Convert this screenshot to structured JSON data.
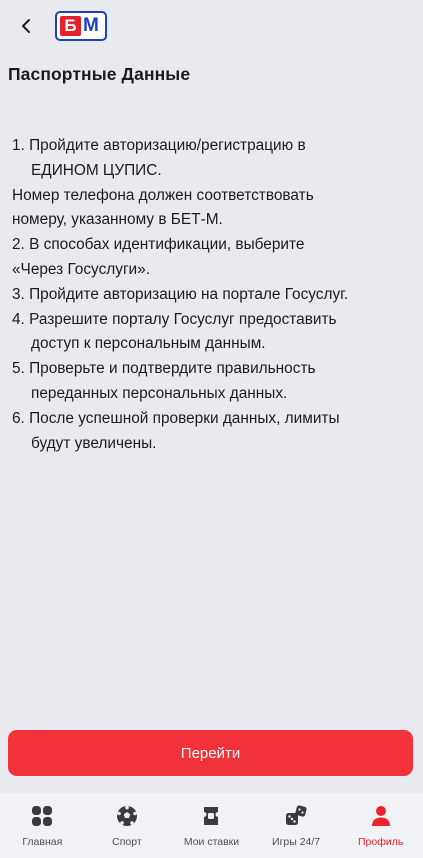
{
  "header": {
    "back_icon": "chevron-left-icon",
    "logo": {
      "letter1": "Б",
      "letter2": "М",
      "colors": {
        "red": "#e5222b",
        "blue": "#1d3fc4"
      }
    }
  },
  "page": {
    "title": "Паспортные Данные"
  },
  "instructions": {
    "lines": [
      "1. Пройдите авторизацию/регистрацию в",
      "ЕДИНОМ ЦУПИС.",
      "Номер телефона должен соответствовать",
      "номеру, указанному в БЕТ-М.",
      "2. В способах идентификации, выберите",
      "«Через Госуслуги».",
      "3. Пройдите авторизацию на портале Госуслуг.",
      "4. Разрешите порталу Госуслуг предоставить",
      "доступ к персональным данным.",
      "5. Проверьте и подтвердите правильность",
      "переданных персональных данных.",
      "6. После успешной проверки данных, лимиты",
      "будут увеличены."
    ]
  },
  "action": {
    "go_label": "Перейти",
    "color": "#f1323a"
  },
  "tabbar": {
    "items": [
      {
        "label": "Главная",
        "icon": "home-grid-icon"
      },
      {
        "label": "Спорт",
        "icon": "soccer-ball-icon"
      },
      {
        "label": "Мои ставки",
        "icon": "ticket-icon"
      },
      {
        "label": "Игры 24/7",
        "icon": "dice-icon"
      },
      {
        "label": "Профиль",
        "icon": "profile-icon",
        "active": true
      }
    ],
    "active_color": "#e9242e",
    "inactive_color": "#3a3b40"
  }
}
